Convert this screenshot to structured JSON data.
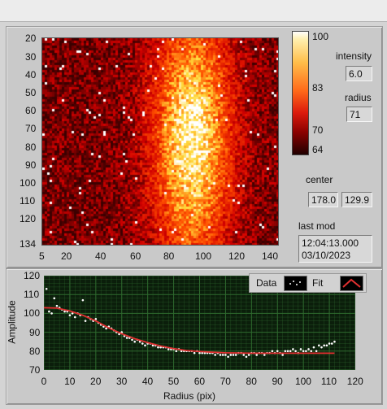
{
  "image_graph": {
    "y_ticks": [
      "20",
      "30",
      "40",
      "50",
      "60",
      "70",
      "80",
      "90",
      "100",
      "110",
      "120",
      "134"
    ],
    "x_ticks": [
      "5",
      "20",
      "40",
      "60",
      "80",
      "100",
      "120",
      "140"
    ],
    "colorbar_ticks": [
      "100",
      "83",
      "70",
      "64"
    ]
  },
  "controls": {
    "intensity_label": "intensity",
    "intensity_value": "6.0",
    "radius_label": "radius",
    "radius_value": "71",
    "center_label": "center",
    "center_x": "178.0",
    "center_y": "129.9",
    "last_mod_label": "last mod",
    "last_mod_time": "12:04:13.000",
    "last_mod_date": "03/10/2023"
  },
  "chart_data": {
    "type": "scatter",
    "xlabel": "Radius (pix)",
    "ylabel": "Amplitude",
    "xlim": [
      0,
      120
    ],
    "ylim": [
      70,
      120
    ],
    "x_ticks": [
      "0",
      "10",
      "20",
      "30",
      "40",
      "50",
      "60",
      "70",
      "80",
      "90",
      "100",
      "110",
      "120"
    ],
    "y_ticks": [
      "120",
      "110",
      "100",
      "90",
      "80",
      "70"
    ],
    "legend": [
      "Data",
      "Fit"
    ],
    "grid": true,
    "series": [
      {
        "name": "Data",
        "x": [
          1,
          2,
          3,
          4,
          5,
          6,
          7,
          8,
          9,
          10,
          11,
          12,
          13,
          14,
          15,
          16,
          17,
          18,
          19,
          20,
          21,
          22,
          23,
          24,
          25,
          26,
          27,
          28,
          29,
          30,
          31,
          32,
          33,
          34,
          35,
          36,
          37,
          38,
          39,
          40,
          41,
          42,
          43,
          44,
          45,
          46,
          47,
          48,
          49,
          50,
          51,
          52,
          53,
          54,
          55,
          56,
          57,
          58,
          59,
          60,
          61,
          62,
          63,
          64,
          65,
          66,
          67,
          68,
          69,
          70,
          71,
          72,
          73,
          74,
          75,
          76,
          77,
          78,
          79,
          80,
          81,
          82,
          83,
          84,
          85,
          86,
          87,
          88,
          89,
          90,
          91,
          92,
          93,
          94,
          95,
          96,
          97,
          98,
          99,
          100,
          101,
          102,
          103,
          104,
          105,
          106,
          107,
          108,
          109,
          110,
          111,
          112
        ],
        "y": [
          113,
          101,
          100,
          108,
          104,
          103,
          102,
          101,
          101,
          99,
          100,
          98,
          100,
          99,
          107,
          96,
          98,
          97,
          96,
          97,
          95,
          94,
          93,
          92,
          93,
          92,
          91,
          90,
          89,
          90,
          88,
          87,
          87,
          86,
          85,
          86,
          85,
          84,
          83,
          84,
          84,
          83,
          83,
          82,
          82,
          82,
          82,
          81,
          81,
          81,
          80,
          81,
          80,
          80,
          80,
          80,
          80,
          79,
          80,
          79,
          79,
          79,
          79,
          79,
          79,
          78,
          79,
          78,
          78,
          78,
          77,
          78,
          78,
          78,
          79,
          79,
          78,
          77,
          78,
          79,
          79,
          78,
          79,
          79,
          78,
          79,
          79,
          80,
          79,
          80,
          79,
          78,
          80,
          80,
          80,
          81,
          80,
          79,
          81,
          80,
          80,
          81,
          80,
          82,
          80,
          83,
          82,
          83,
          83,
          84,
          84,
          85
        ]
      },
      {
        "name": "Fit",
        "x": [
          0,
          5,
          10,
          15,
          20,
          25,
          30,
          35,
          40,
          45,
          50,
          55,
          60,
          65,
          70,
          75,
          80,
          85,
          90,
          95,
          100,
          105,
          110,
          112
        ],
        "y": [
          103,
          102.8,
          101.3,
          99,
          96,
          92.3,
          89.2,
          86.6,
          84.5,
          82.7,
          81.3,
          80.3,
          79.8,
          79.4,
          79.1,
          79,
          78.9,
          78.9,
          78.9,
          78.9,
          78.9,
          78.9,
          78.9,
          78.9
        ]
      }
    ]
  },
  "colors": {
    "plot_bg": "#0b1e0b",
    "grid": "#2f6b2f",
    "fit_line": "#e03030",
    "data_points": "#ffffff"
  }
}
